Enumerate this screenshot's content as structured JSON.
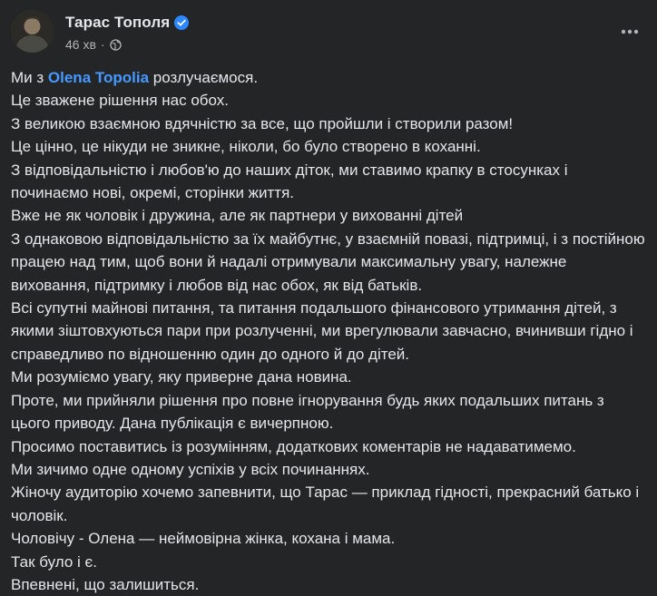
{
  "post": {
    "author": "Тарас Тополя",
    "time": "46 хв",
    "separator": "·",
    "icons": {
      "verified": "verified-badge-icon",
      "audience": "globe-icon",
      "more": "more-options-icon"
    },
    "colors": {
      "background": "#242526",
      "text": "#e4e6eb",
      "secondary": "#b0b3b8",
      "mention": "#4599ff",
      "verified": "#2d88ff"
    },
    "mention_before": "Ми з ",
    "mention": "Olena Topolia",
    "mention_after": " розлучаємося.",
    "lines": [
      "Це зважене рішення нас обох.",
      "З великою взаємною вдячністю за все, що пройшли і створили разом!",
      "Це цінно, це нікуди не зникне, ніколи, бо було створено в коханні.",
      "З відповідальністю і любов'ю до наших діток, ми ставимо крапку в стосунках і починаємо нові, окремі, сторінки життя.",
      "Вже не як чоловік і дружина, але як партнери у вихованні дітей",
      "З однаковою відповідальністю за їх майбутнє, у взаємній повазі, підтримці, і з постійною працею над тим, щоб вони й надалі отримували максимальну увагу, належне виховання, підтримку і любов від нас обох, як від батьків.",
      "Всі супутні майнові питання, та питання подальшого фінансового утримання дітей, з якими зіштовхуються пари при розлученні, ми врегулювали завчасно, вчинивши гідно і справедливо по відношенню один до одного й до дітей.",
      "Ми розуміємо увагу, яку приверне дана новина.",
      "Проте, ми прийняли рішення про повне ігнорування будь яких подальших питань з цього приводу. Дана публікація є вичерпною.",
      "Просимо поставитись із розумінням, додаткових коментарів не надаватимемо.",
      "Ми зичимо одне одному успіхів у всіх починаннях.",
      "Жіночу аудиторію хочемо запевнити, що Тарас — приклад гідності, прекрасний батько і чоловік.",
      "Чоловічу - Олена — неймовірна жінка, кохана і мама.",
      "Так було і є.",
      "Впевнені, що залишиться."
    ]
  }
}
